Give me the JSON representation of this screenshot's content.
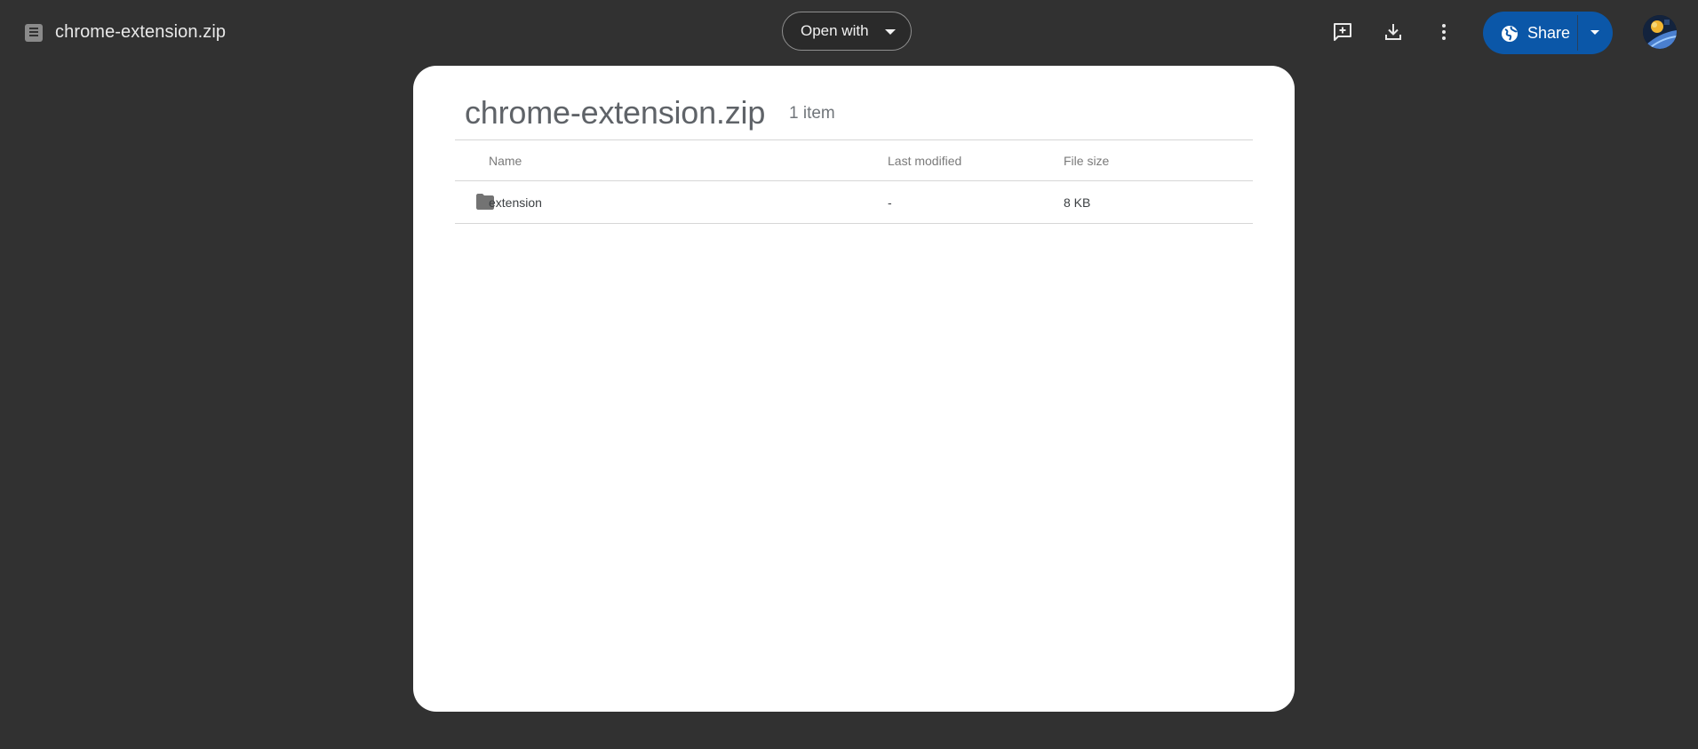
{
  "header": {
    "file_name": "chrome-extension.zip",
    "open_with_label": "Open with",
    "share_label": "Share",
    "icons": [
      "archive-file-icon",
      "add-comment-icon",
      "download-icon",
      "more-options-icon",
      "globe-icon",
      "avatar"
    ]
  },
  "archive": {
    "title": "chrome-extension.zip",
    "item_count": "1 item",
    "columns": [
      "Name",
      "Last modified",
      "File size"
    ],
    "rows": [
      {
        "icon": "folder-icon",
        "name": "extension",
        "last_modified": "-",
        "file_size": "8 KB"
      }
    ]
  },
  "colors": {
    "background": "#313131",
    "share_button": "#0b57a8",
    "card": "#ffffff"
  }
}
